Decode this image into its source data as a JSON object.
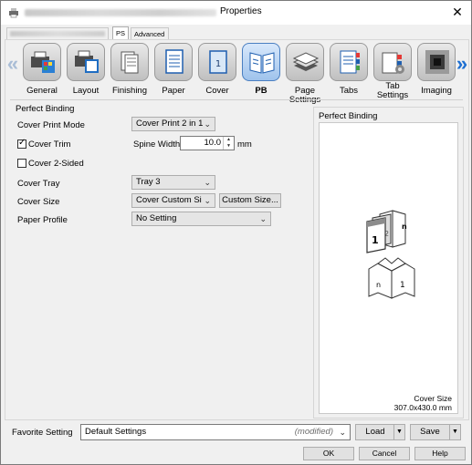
{
  "window": {
    "title": "Properties",
    "close_glyph": "✕"
  },
  "tabs": {
    "ps": "PS",
    "advanced": "Advanced"
  },
  "icon_bar": {
    "left_arrow": "«",
    "right_arrow": "»",
    "items": [
      {
        "label": "General",
        "icon": "general-icon"
      },
      {
        "label": "Layout",
        "icon": "layout-icon"
      },
      {
        "label": "Finishing",
        "icon": "finishing-icon"
      },
      {
        "label": "Paper",
        "icon": "paper-icon"
      },
      {
        "label": "Cover",
        "icon": "cover-icon"
      },
      {
        "label": "PB",
        "icon": "perfect-binding-icon",
        "selected": true
      },
      {
        "label": "Page Settings",
        "icon": "page-settings-icon"
      },
      {
        "label": "Tabs",
        "icon": "tabs-icon"
      },
      {
        "label": "Tab Settings",
        "icon": "tab-settings-icon"
      },
      {
        "label": "Imaging",
        "icon": "imaging-icon"
      }
    ]
  },
  "perfect_binding": {
    "section_title": "Perfect Binding",
    "cover_print_mode_label": "Cover Print Mode",
    "cover_print_mode_value": "Cover Print 2 in 1",
    "cover_trim_label": "Cover Trim",
    "cover_trim_checked": true,
    "spine_width_label": "Spine Width",
    "spine_width_value": "10.0",
    "spine_width_unit": "mm",
    "cover_2sided_label": "Cover 2-Sided",
    "cover_2sided_checked": false,
    "cover_tray_label": "Cover Tray",
    "cover_tray_value": "Tray 3",
    "cover_size_label": "Cover Size",
    "cover_size_value": "Cover Custom Size",
    "custom_size_button": "Custom Size...",
    "paper_profile_label": "Paper Profile",
    "paper_profile_value": "No Setting"
  },
  "preview": {
    "title": "Perfect Binding",
    "caption_label": "Cover Size",
    "caption_value": "307.0x430.0 mm"
  },
  "favorite": {
    "label": "Favorite Setting",
    "value": "Default Settings",
    "modified": "(modified)",
    "load_button": "Load",
    "save_button": "Save"
  },
  "footer": {
    "ok": "OK",
    "cancel": "Cancel",
    "help": "Help"
  },
  "colors": {
    "selected_tile": "#9fc3ec",
    "nav_arrow_active": "#1d6fd1",
    "nav_arrow_inactive": "#a9bdd6"
  }
}
